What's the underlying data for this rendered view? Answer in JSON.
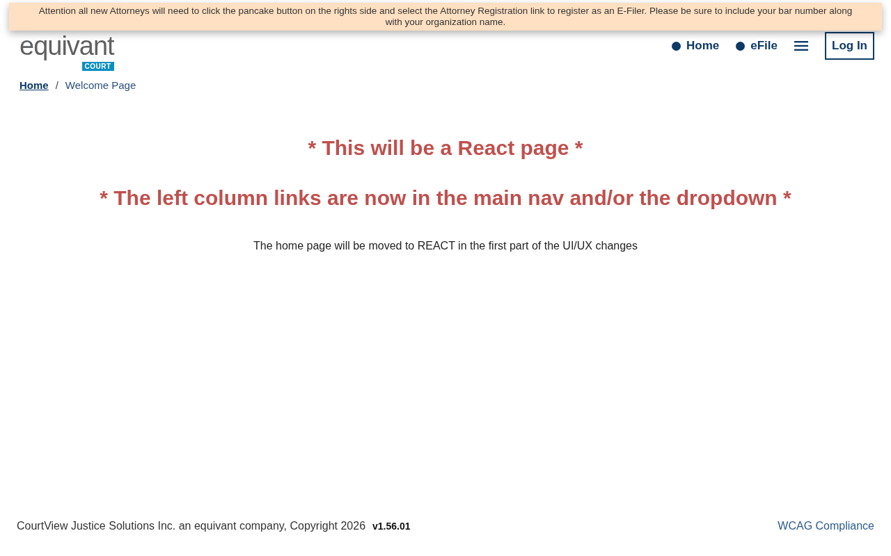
{
  "banner": {
    "text": "Attention all new Attorneys will need to click the pancake button on the rights side and select the Attorney Registration link to register as an E-Filer. Please be sure to include your bar number along with your organization name."
  },
  "logo": {
    "wordmark": "equivant",
    "tag": "COURT"
  },
  "nav": {
    "links": [
      {
        "label": "Home"
      },
      {
        "label": "eFile"
      }
    ],
    "login": "Log In"
  },
  "breadcrumb": [
    {
      "label": "Home",
      "kind": "link"
    },
    {
      "label": "/",
      "kind": "separator"
    },
    {
      "label": "Welcome Page",
      "kind": "current"
    }
  ],
  "headings": [
    "* This will be a React page *",
    "* The left column links are now in the main nav and/or the dropdown *"
  ],
  "message": "The home page will be moved to REACT in the first part of the UI/UX changes",
  "footer": {
    "copyright": "CourtView Justice Solutions Inc. an equivant company, Copyright 2026",
    "version": "v1.56.01",
    "link": "WCAG Compliance"
  }
}
